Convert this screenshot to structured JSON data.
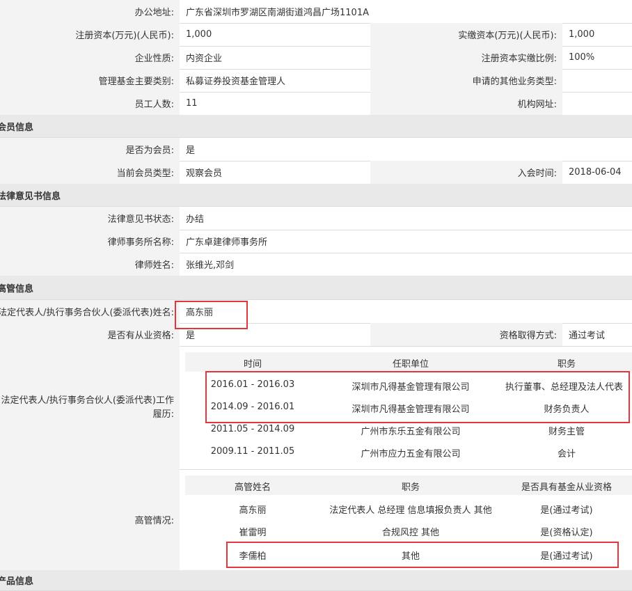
{
  "basic": {
    "office_address_label": "办公地址:",
    "office_address": "广东省深圳市罗湖区南湖街道鸿昌广场1101A",
    "reg_capital_label": "注册资本(万元)(人民币):",
    "reg_capital": "1,000",
    "paid_capital_label": "实缴资本(万元)(人民币):",
    "paid_capital": "1,000",
    "nature_label": "企业性质:",
    "nature": "内资企业",
    "paid_ratio_label": "注册资本实缴比例:",
    "paid_ratio": "100%",
    "fund_type_label": "管理基金主要类别:",
    "fund_type": "私募证券投资基金管理人",
    "other_biz_label": "申请的其他业务类型:",
    "other_biz": "",
    "staff_label": "员工人数:",
    "staff": "11",
    "website_label": "机构网址:",
    "website": ""
  },
  "member": {
    "section_title": "会员信息",
    "is_member_label": "是否为会员:",
    "is_member": "是",
    "type_label": "当前会员类型:",
    "type": "观察会员",
    "join_label": "入会时间:",
    "join_date": "2018-06-04"
  },
  "legal": {
    "section_title": "法律意见书信息",
    "status_label": "法律意见书状态:",
    "status": "办结",
    "firm_label": "律师事务所名称:",
    "firm": "广东卓建律师事务所",
    "lawyer_label": "律师姓名:",
    "lawyer": "张维光,邓剑"
  },
  "exec": {
    "section_title": "高管信息",
    "rep_label": "法定代表人/执行事务合伙人(委派代表)姓名:",
    "rep_name": "高东丽",
    "qualified_label": "是否有从业资格:",
    "qualified": "是",
    "qual_method_label": "资格取得方式:",
    "qual_method": "通过考试",
    "history_label": "法定代表人/执行事务合伙人(委派代表)工作履历:",
    "history_headers": [
      "时间",
      "任职单位",
      "职务"
    ],
    "history": [
      {
        "time": "2016.01 - 2016.03",
        "org": "深圳市凡得基金管理有限公司",
        "role": "执行董事、总经理及法人代表"
      },
      {
        "time": "2014.09 - 2016.01",
        "org": "深圳市凡得基金管理有限公司",
        "role": "财务负责人"
      },
      {
        "time": "2011.05 - 2014.09",
        "org": "广州市东乐五金有限公司",
        "role": "财务主管"
      },
      {
        "time": "2009.11 - 2011.05",
        "org": "广州市应力五金有限公司",
        "role": "会计"
      }
    ],
    "managers_label": "高管情况:",
    "managers_headers": [
      "高管姓名",
      "职务",
      "是否具有基金从业资格"
    ],
    "managers": [
      {
        "name": "高东丽",
        "role": "法定代表人 总经理 信息填报负责人 其他",
        "qual": "是(通过考试)"
      },
      {
        "name": "崔雷明",
        "role": "合规风控 其他",
        "qual": "是(资格认定)"
      },
      {
        "name": "李儒柏",
        "role": "其他",
        "qual": "是(通过考试)"
      }
    ]
  },
  "next_section": {
    "section_title": "产品信息"
  },
  "colors": {
    "label_bg": "#f3f3f3",
    "section_bg": "#e9e9e9",
    "highlight": "#e0363c"
  }
}
